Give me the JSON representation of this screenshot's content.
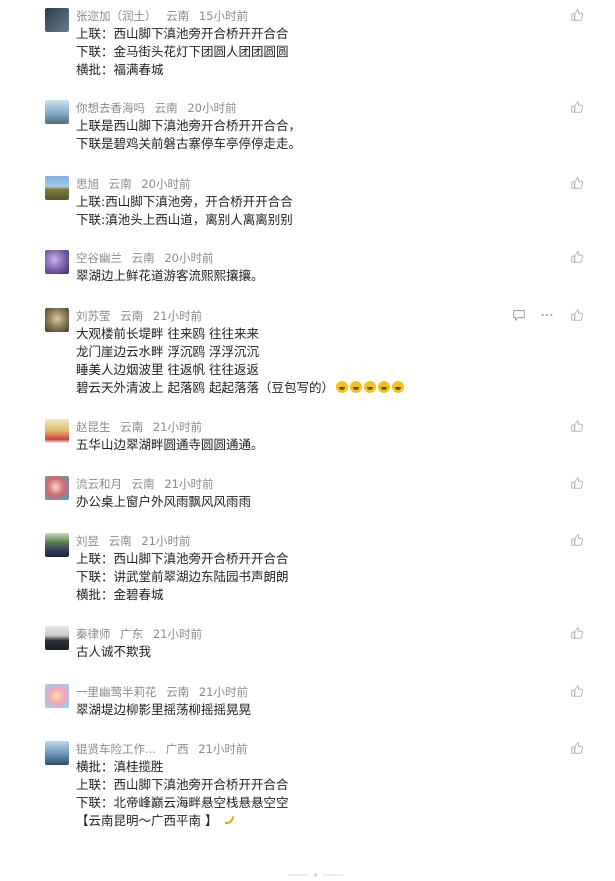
{
  "colors": {
    "meta": "#8a8a8a",
    "text": "#1f1f1f",
    "icon": "#b5b5b5",
    "emoji": "#f4c21f"
  },
  "icons": {
    "like": "thumbs-up-icon",
    "reply": "comment-icon",
    "more": "more-dots-icon"
  },
  "comments": [
    {
      "user": "张迩加（润土）",
      "region": "云南",
      "time": "15小时前",
      "lines": [
        "上联：西山脚下滇池旁开合桥开开合合",
        "下联：金马街头花灯下团圆人团团圆圆",
        "横批：福满春城"
      ]
    },
    {
      "user": "你想去香海吗",
      "region": "云南",
      "time": "20小时前",
      "lines": [
        "上联是西山脚下滇池旁开合桥开开合合，",
        "下联是碧鸡关前磐古寨停车亭停停走走。"
      ]
    },
    {
      "user": "思旭",
      "region": "云南",
      "time": "20小时前",
      "lines": [
        "上联:西山脚下滇池旁，开合桥开开合合",
        "下联:滇池头上西山道，离别人离离别别"
      ]
    },
    {
      "user": "空谷幽兰",
      "region": "云南",
      "time": "20小时前",
      "lines": [
        "翠湖边上鲜花道游客流熙熙攘攘。"
      ]
    },
    {
      "user": "刘苏莹",
      "region": "云南",
      "time": "21小时前",
      "lines": [
        "大观楼前长堤畔 往来鸥 往往来来",
        "龙门崖边云水畔 浮沉鸥 浮浮沉沉",
        "睡美人边烟波里 往返帆 往往返返",
        "碧云天外清波上 起落鸥 起起落落（豆包写的）"
      ]
    },
    {
      "user": "赵昆生",
      "region": "云南",
      "time": "21小时前",
      "lines": [
        "五华山边翠湖畔圆通寺圆圆通通。"
      ]
    },
    {
      "user": "流云和月",
      "region": "云南",
      "time": "21小时前",
      "lines": [
        "办公桌上窗户外风雨飘风风雨雨"
      ]
    },
    {
      "user": "刘昱",
      "region": "云南",
      "time": "21小时前",
      "lines": [
        "上联：西山脚下滇池旁开合桥开开合合",
        "下联：讲武堂前翠湖边东陆园书声朗朗",
        "横批：金碧春城"
      ]
    },
    {
      "user": "秦律师",
      "region": "广东",
      "time": "21小时前",
      "lines": [
        "古人诚不欺我"
      ]
    },
    {
      "user": "一里幽莺半莉花",
      "region": "云南",
      "time": "21小时前",
      "lines": [
        "翠湖堤边柳影里摇荡柳摇摇晃晃"
      ]
    },
    {
      "user": "锟贤车险工作...",
      "region": "广西",
      "time": "21小时前",
      "lines": [
        "横批：滇桂揽胜",
        "上联：西山脚下滇池旁开合桥开开合合",
        "下联：北帝峰巅云海畔悬空栈悬悬空空",
        "【云南昆明～广西平南 】"
      ]
    }
  ]
}
